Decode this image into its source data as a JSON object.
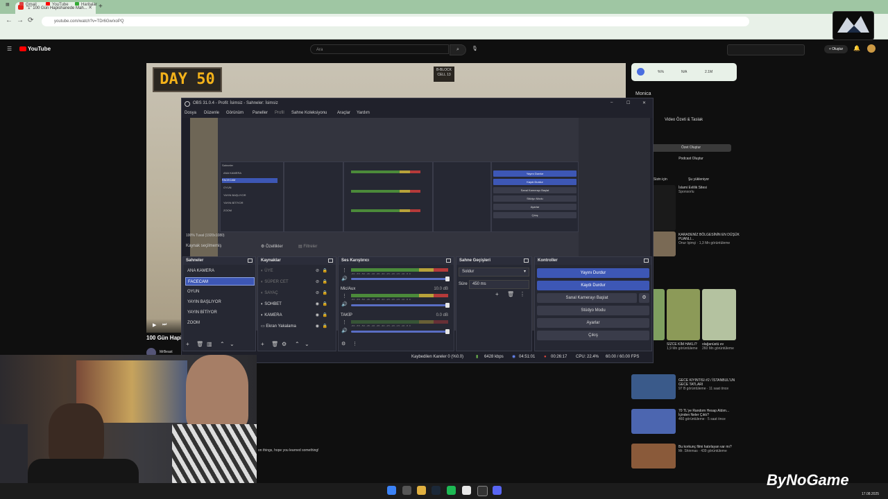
{
  "browser": {
    "tab_title": "\"1\" 100 Gün Hapishanede Mah...",
    "url": "youtube.com/watch?v=TDr6Gw/xoPQ",
    "bookmarks": [
      "Gmail",
      "YouTube",
      "Haritalar"
    ]
  },
  "youtube": {
    "logo": "YouTube",
    "search_placeholder": "Ara",
    "create_label": "Oluştur",
    "video_title": "100 Gün Hapis",
    "channel": "MrBeast",
    "comment_snippet": "on things, hope you learned something!",
    "sidebar": {
      "top_stats": [
        "%%",
        "N/A",
        "2.1M"
      ],
      "monica_title": "Monica",
      "monica_card_title": "Video Özeti & Taslak",
      "monica_btn1": "Özet Oluştur",
      "monica_btn2": "Podcast Oluştur",
      "chips": [
        "Tümü",
        "Sizin için",
        "Şu yükleniyor"
      ],
      "items": [
        {
          "title": "İslami Evlilik Sitesi",
          "meta": "Sponsorlu"
        },
        {
          "title": "KARADENİZ BÖLGESİNİN EN DÜŞÜK PUANLI...",
          "meta": "Onur Işimçi · 1,3 Mn görüntüleme"
        },
        {
          "title": "SİZCE KİM HAKLI?",
          "meta": "1,9 Mn görüntüleme"
        },
        {
          "title": "olağanüstü ev",
          "meta": "260 Mn görüntüleme"
        },
        {
          "title": "GECE KIYINTISI #2 / İSTANBUL'UN GECE TATLARI",
          "meta": "97 B görüntüleme · 11 saat önce"
        },
        {
          "title": "70 TL'ye Random Hesap Aldım... İçinden Neler Çıktı?",
          "meta": "460 görüntüleme · 5 saat önce"
        },
        {
          "title": "Bu korkunç filmi hatırlayan var mı?",
          "meta": "Mr. Shinmas · 439 görüntüleme"
        }
      ]
    }
  },
  "obs": {
    "title": "OBS 31.0.4 - Profil: İsimsiz - Sahneler: İsimsiz",
    "menu": [
      "Dosya",
      "Düzenle",
      "Görünüm",
      "Paneller",
      "Profil",
      "Sahne Koleksiyonu",
      "Araçlar",
      "Yardım"
    ],
    "preview_status": "100%  Tuval (1920x1080)",
    "no_source": "Kaynak seçilmemiş",
    "props_label": "Özellikler",
    "filters_label": "Filtreler",
    "docks": {
      "scenes": "Sahneler",
      "sources": "Kaynaklar",
      "mixer": "Ses Karıştırıcı",
      "transitions": "Sahne Geçişleri",
      "controls": "Kontroller"
    },
    "scenes": [
      "ANA KAMERA",
      "FACECAM",
      "OYUN",
      "YAYIN BAŞLIYOR",
      "YAYIN BİTİYOR",
      "ZOOM"
    ],
    "selected_scene": "FACECAM",
    "sources": [
      {
        "name": "ÜYE",
        "visible": false
      },
      {
        "name": "SÜPER CET",
        "visible": false
      },
      {
        "name": "SAYAÇ",
        "visible": false
      },
      {
        "name": "SOHBET",
        "visible": true
      },
      {
        "name": "KAMERA",
        "visible": true
      },
      {
        "name": "Ekran Yakalama",
        "visible": true
      }
    ],
    "mixer": {
      "scale": "-60 -55 -50 -45 -40 -35 -30 -25 -20 -15 -10 -5 0",
      "channels": [
        {
          "name": "",
          "value": ""
        },
        {
          "name": "Mic/Aux",
          "value": "10.0 dB"
        },
        {
          "name": "TAKİP",
          "value": "0.0 dB"
        }
      ]
    },
    "transition": {
      "type": "Soldur",
      "duration_label": "Süre",
      "duration": "450 ms"
    },
    "controls": [
      "Yayını Durdur",
      "Kaydı Durdur",
      "Sanal Kamerayı Başlat",
      "Stüdyo Modu",
      "Ayarlar",
      "Çıkış"
    ],
    "status": {
      "dropped": "Kaybedilen Kareler 0 (%0.0)",
      "bitrate": "6428 kbps",
      "stream_time": "04:51:01",
      "rec_time": "00:26:17",
      "cpu": "CPU: 22.4%",
      "fps": "60.00 / 60.00 FPS"
    }
  },
  "overlay": {
    "day_label": "DAY 50",
    "block_label": "B-BLOCK CELL 13",
    "brand": "ByNoGame",
    "date": "17.08.2025"
  },
  "colors": {
    "obs_accent": "#3d57b5",
    "obs_bg": "#1e1f29",
    "browser_chrome": "#e8f1e8",
    "youtube_red": "#ff0000"
  }
}
